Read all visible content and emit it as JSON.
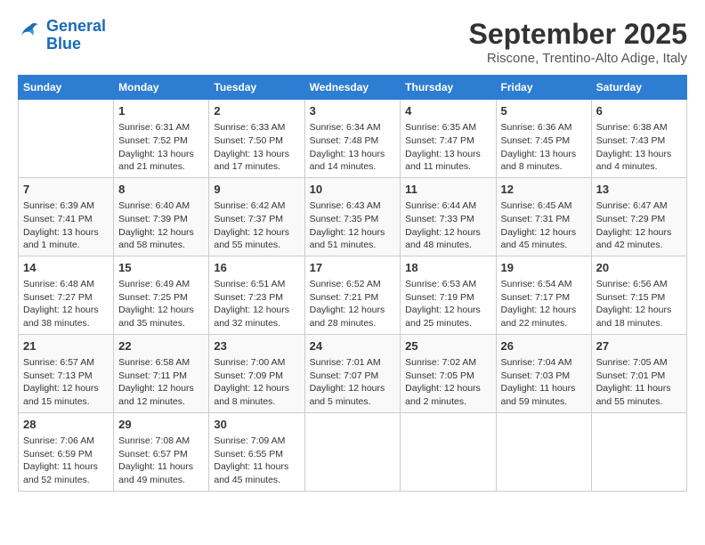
{
  "header": {
    "logo_line1": "General",
    "logo_line2": "Blue",
    "month": "September 2025",
    "location": "Riscone, Trentino-Alto Adige, Italy"
  },
  "days_of_week": [
    "Sunday",
    "Monday",
    "Tuesday",
    "Wednesday",
    "Thursday",
    "Friday",
    "Saturday"
  ],
  "weeks": [
    [
      {
        "day": "",
        "content": ""
      },
      {
        "day": "1",
        "content": "Sunrise: 6:31 AM\nSunset: 7:52 PM\nDaylight: 13 hours\nand 21 minutes."
      },
      {
        "day": "2",
        "content": "Sunrise: 6:33 AM\nSunset: 7:50 PM\nDaylight: 13 hours\nand 17 minutes."
      },
      {
        "day": "3",
        "content": "Sunrise: 6:34 AM\nSunset: 7:48 PM\nDaylight: 13 hours\nand 14 minutes."
      },
      {
        "day": "4",
        "content": "Sunrise: 6:35 AM\nSunset: 7:47 PM\nDaylight: 13 hours\nand 11 minutes."
      },
      {
        "day": "5",
        "content": "Sunrise: 6:36 AM\nSunset: 7:45 PM\nDaylight: 13 hours\nand 8 minutes."
      },
      {
        "day": "6",
        "content": "Sunrise: 6:38 AM\nSunset: 7:43 PM\nDaylight: 13 hours\nand 4 minutes."
      }
    ],
    [
      {
        "day": "7",
        "content": "Sunrise: 6:39 AM\nSunset: 7:41 PM\nDaylight: 13 hours\nand 1 minute."
      },
      {
        "day": "8",
        "content": "Sunrise: 6:40 AM\nSunset: 7:39 PM\nDaylight: 12 hours\nand 58 minutes."
      },
      {
        "day": "9",
        "content": "Sunrise: 6:42 AM\nSunset: 7:37 PM\nDaylight: 12 hours\nand 55 minutes."
      },
      {
        "day": "10",
        "content": "Sunrise: 6:43 AM\nSunset: 7:35 PM\nDaylight: 12 hours\nand 51 minutes."
      },
      {
        "day": "11",
        "content": "Sunrise: 6:44 AM\nSunset: 7:33 PM\nDaylight: 12 hours\nand 48 minutes."
      },
      {
        "day": "12",
        "content": "Sunrise: 6:45 AM\nSunset: 7:31 PM\nDaylight: 12 hours\nand 45 minutes."
      },
      {
        "day": "13",
        "content": "Sunrise: 6:47 AM\nSunset: 7:29 PM\nDaylight: 12 hours\nand 42 minutes."
      }
    ],
    [
      {
        "day": "14",
        "content": "Sunrise: 6:48 AM\nSunset: 7:27 PM\nDaylight: 12 hours\nand 38 minutes."
      },
      {
        "day": "15",
        "content": "Sunrise: 6:49 AM\nSunset: 7:25 PM\nDaylight: 12 hours\nand 35 minutes."
      },
      {
        "day": "16",
        "content": "Sunrise: 6:51 AM\nSunset: 7:23 PM\nDaylight: 12 hours\nand 32 minutes."
      },
      {
        "day": "17",
        "content": "Sunrise: 6:52 AM\nSunset: 7:21 PM\nDaylight: 12 hours\nand 28 minutes."
      },
      {
        "day": "18",
        "content": "Sunrise: 6:53 AM\nSunset: 7:19 PM\nDaylight: 12 hours\nand 25 minutes."
      },
      {
        "day": "19",
        "content": "Sunrise: 6:54 AM\nSunset: 7:17 PM\nDaylight: 12 hours\nand 22 minutes."
      },
      {
        "day": "20",
        "content": "Sunrise: 6:56 AM\nSunset: 7:15 PM\nDaylight: 12 hours\nand 18 minutes."
      }
    ],
    [
      {
        "day": "21",
        "content": "Sunrise: 6:57 AM\nSunset: 7:13 PM\nDaylight: 12 hours\nand 15 minutes."
      },
      {
        "day": "22",
        "content": "Sunrise: 6:58 AM\nSunset: 7:11 PM\nDaylight: 12 hours\nand 12 minutes."
      },
      {
        "day": "23",
        "content": "Sunrise: 7:00 AM\nSunset: 7:09 PM\nDaylight: 12 hours\nand 8 minutes."
      },
      {
        "day": "24",
        "content": "Sunrise: 7:01 AM\nSunset: 7:07 PM\nDaylight: 12 hours\nand 5 minutes."
      },
      {
        "day": "25",
        "content": "Sunrise: 7:02 AM\nSunset: 7:05 PM\nDaylight: 12 hours\nand 2 minutes."
      },
      {
        "day": "26",
        "content": "Sunrise: 7:04 AM\nSunset: 7:03 PM\nDaylight: 11 hours\nand 59 minutes."
      },
      {
        "day": "27",
        "content": "Sunrise: 7:05 AM\nSunset: 7:01 PM\nDaylight: 11 hours\nand 55 minutes."
      }
    ],
    [
      {
        "day": "28",
        "content": "Sunrise: 7:06 AM\nSunset: 6:59 PM\nDaylight: 11 hours\nand 52 minutes."
      },
      {
        "day": "29",
        "content": "Sunrise: 7:08 AM\nSunset: 6:57 PM\nDaylight: 11 hours\nand 49 minutes."
      },
      {
        "day": "30",
        "content": "Sunrise: 7:09 AM\nSunset: 6:55 PM\nDaylight: 11 hours\nand 45 minutes."
      },
      {
        "day": "",
        "content": ""
      },
      {
        "day": "",
        "content": ""
      },
      {
        "day": "",
        "content": ""
      },
      {
        "day": "",
        "content": ""
      }
    ]
  ]
}
